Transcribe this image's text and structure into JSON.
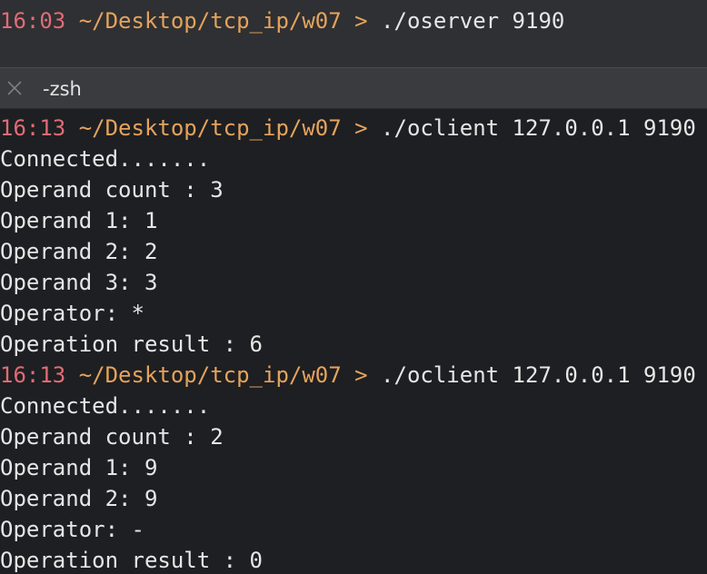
{
  "top_pane": {
    "prompt": {
      "time": "16:03",
      "path": "~/Desktop/tcp_ip/w07",
      "arrow": ">",
      "command": "./oserver 9190"
    }
  },
  "tab": {
    "title": "-zsh",
    "close_icon": "close-icon"
  },
  "session": {
    "runs": [
      {
        "prompt": {
          "time": "16:13",
          "path": "~/Desktop/tcp_ip/w07",
          "arrow": ">",
          "command": "./oclient 127.0.0.1 9190"
        },
        "output": [
          "Connected.......",
          "Operand count : 3",
          "Operand 1: 1",
          "Operand 2: 2",
          "Operand 3: 3",
          "Operator: *",
          "Operation result : 6"
        ]
      },
      {
        "prompt": {
          "time": "16:13",
          "path": "~/Desktop/tcp_ip/w07",
          "arrow": ">",
          "command": "./oclient 127.0.0.1 9190"
        },
        "output": [
          "Connected.......",
          "Operand count : 2",
          "Operand 1: 9",
          "Operand 2: 9",
          "Operator: -",
          "Operation result : 0"
        ]
      }
    ]
  },
  "colors": {
    "time": "#e06c75",
    "path": "#e5a35c",
    "text": "#e6e6e6",
    "background": "#1e1f22",
    "tabbar": "#3a3b3e"
  }
}
